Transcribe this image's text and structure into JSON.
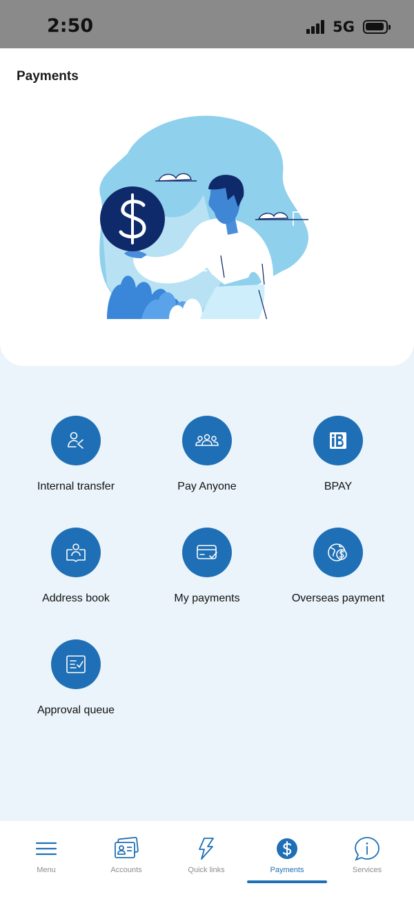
{
  "status_bar": {
    "time": "2:50",
    "network": "5G"
  },
  "page": {
    "title": "Payments"
  },
  "actions": [
    {
      "label": "Internal transfer",
      "icon": "internal-transfer-icon"
    },
    {
      "label": "Pay Anyone",
      "icon": "pay-anyone-icon"
    },
    {
      "label": "BPAY",
      "icon": "bpay-icon"
    },
    {
      "label": "Address book",
      "icon": "address-book-icon"
    },
    {
      "label": "My payments",
      "icon": "my-payments-icon"
    },
    {
      "label": "Overseas payment",
      "icon": "overseas-payment-icon"
    },
    {
      "label": "Approval queue",
      "icon": "approval-queue-icon"
    }
  ],
  "bottom_nav": {
    "active": "Payments",
    "items": [
      {
        "label": "Menu",
        "icon": "menu-icon"
      },
      {
        "label": "Accounts",
        "icon": "accounts-icon"
      },
      {
        "label": "Quick links",
        "icon": "quick-links-icon"
      },
      {
        "label": "Payments",
        "icon": "payments-icon"
      },
      {
        "label": "Services",
        "icon": "services-icon"
      }
    ]
  },
  "colors": {
    "brand_blue": "#1e6fb5",
    "navy": "#0f2a6b",
    "page_background": "#ebf4fa",
    "hero_light_blue": "#8fd0ec"
  }
}
